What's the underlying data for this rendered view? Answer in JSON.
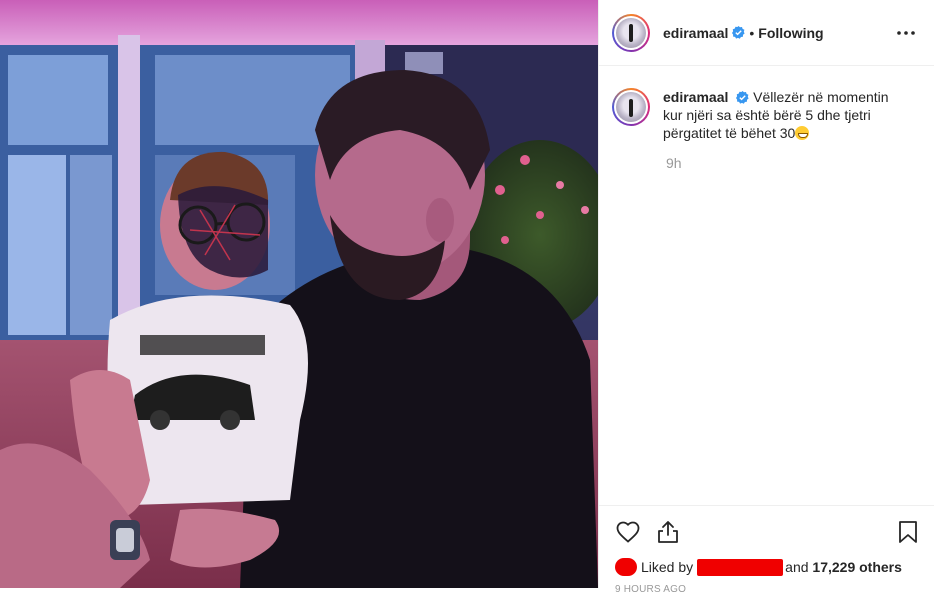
{
  "post": {
    "photo_alt": "",
    "username": "ediramaal",
    "verified_icon": "verified-badge-icon",
    "follow_status": "Following",
    "more_icon": "more-options-icon"
  },
  "comment": {
    "username": "ediramaal",
    "text": "Vëllezër në momentin kur njëri sa është bërë 5 dhe tjetri përgatitet të bëhet 30",
    "emoji": "grinning-face-emoji",
    "time": "9h"
  },
  "actions": {
    "like_icon": "heart-icon",
    "share_icon": "share-icon",
    "save_icon": "bookmark-icon"
  },
  "likes": {
    "prefix": "Liked by",
    "suffix": "and",
    "count": "17,229 others"
  },
  "footer": {
    "time_label": "9 hours ago"
  },
  "colors": {
    "verified": "#3897f0",
    "redaction": "#f00000",
    "muted": "#999999",
    "text": "#262626"
  }
}
